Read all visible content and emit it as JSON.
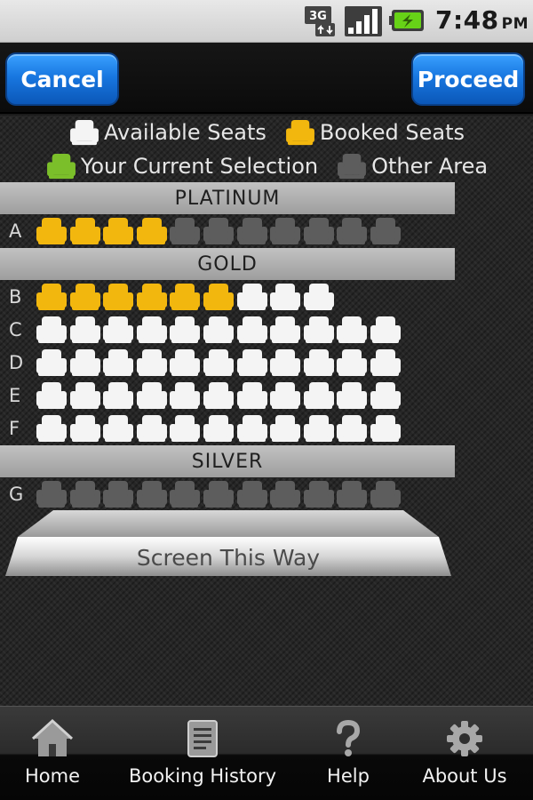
{
  "status_bar": {
    "network": "3G",
    "time": "7:48",
    "ampm": "PM",
    "icons": [
      "3g-data-icon",
      "signal-icon",
      "battery-charging-icon"
    ]
  },
  "action_bar": {
    "cancel_label": "Cancel",
    "proceed_label": "Proceed"
  },
  "legend": {
    "available": "Available Seats",
    "booked": "Booked Seats",
    "current": "Your Current Selection",
    "other": "Other Area"
  },
  "seat_colors": {
    "available": "#f4f4f4",
    "booked": "#f2b70e",
    "current": "#7bbf2a",
    "other": "#5d5d5d"
  },
  "sections": [
    {
      "name": "PLATINUM",
      "rows": [
        {
          "label": "A",
          "seats": [
            "booked",
            "booked",
            "booked",
            "booked",
            "other",
            "other",
            "other",
            "other",
            "other",
            "other",
            "other"
          ]
        }
      ]
    },
    {
      "name": "GOLD",
      "rows": [
        {
          "label": "B",
          "seats": [
            "booked",
            "booked",
            "booked",
            "booked",
            "booked",
            "booked",
            "available",
            "available",
            "available"
          ]
        },
        {
          "label": "C",
          "seats": [
            "available",
            "available",
            "available",
            "available",
            "available",
            "available",
            "available",
            "available",
            "available",
            "available",
            "available"
          ]
        },
        {
          "label": "D",
          "seats": [
            "available",
            "available",
            "available",
            "available",
            "available",
            "available",
            "available",
            "available",
            "available",
            "available",
            "available"
          ]
        },
        {
          "label": "E",
          "seats": [
            "available",
            "available",
            "available",
            "available",
            "available",
            "available",
            "available",
            "available",
            "available",
            "available",
            "available"
          ]
        },
        {
          "label": "F",
          "seats": [
            "available",
            "available",
            "available",
            "available",
            "available",
            "available",
            "available",
            "available",
            "available",
            "available",
            "available"
          ]
        }
      ]
    },
    {
      "name": "SILVER",
      "rows": [
        {
          "label": "G",
          "seats": [
            "other",
            "other",
            "other",
            "other",
            "other",
            "other",
            "other",
            "other",
            "other",
            "other",
            "other"
          ]
        }
      ]
    }
  ],
  "screen": {
    "label": "Screen This Way"
  },
  "bottom_nav": [
    {
      "label": "Home",
      "icon": "home-icon"
    },
    {
      "label": "Booking History",
      "icon": "document-icon"
    },
    {
      "label": "Help",
      "icon": "question-icon"
    },
    {
      "label": "About Us",
      "icon": "gear-icon"
    }
  ]
}
